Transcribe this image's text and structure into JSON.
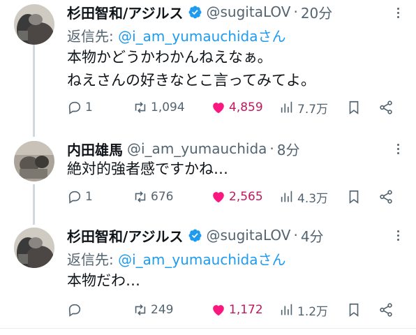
{
  "tweets": [
    {
      "name": "杉田智和/アジルス",
      "handle": "@sugitaLOV",
      "dot": "·",
      "time": "20分",
      "reply_prefix": "返信先: ",
      "reply_mention": "@i_am_yumauchidaさん",
      "lines": [
        "本物かどうかわかんねえなぁ。",
        "ねえさんの好きなとこ言ってみてよ。"
      ],
      "replies": "1",
      "retweets": "1,094",
      "likes": "4,859",
      "views": "7.7万",
      "verified": true
    },
    {
      "name": "内田雄馬",
      "handle": "@i_am_yumauchida",
      "dot": "·",
      "time": "8分",
      "lines": [
        "絶対的強者感ですかね…"
      ],
      "replies": "1",
      "retweets": "676",
      "likes": "2,565",
      "views": "4.3万",
      "verified": false
    },
    {
      "name": "杉田智和/アジルス",
      "handle": "@sugitaLOV",
      "dot": "·",
      "time": "4分",
      "reply_prefix": "返信先: ",
      "reply_mention": "@i_am_yumauchidaさん",
      "lines": [
        "本物だわ…"
      ],
      "replies": "",
      "retweets": "249",
      "likes": "1,172",
      "views": "1.2万",
      "verified": true
    }
  ],
  "colors": {
    "verified": "#1d9bf0",
    "like": "#f91880",
    "muted": "#536471",
    "mention": "#1d9bf0",
    "thread_line": "#cfd9de"
  },
  "icons": [
    "reply-icon",
    "retweet-icon",
    "like-icon",
    "views-icon",
    "bookmark-icon",
    "share-icon",
    "verified-badge-icon",
    "more-icon"
  ]
}
